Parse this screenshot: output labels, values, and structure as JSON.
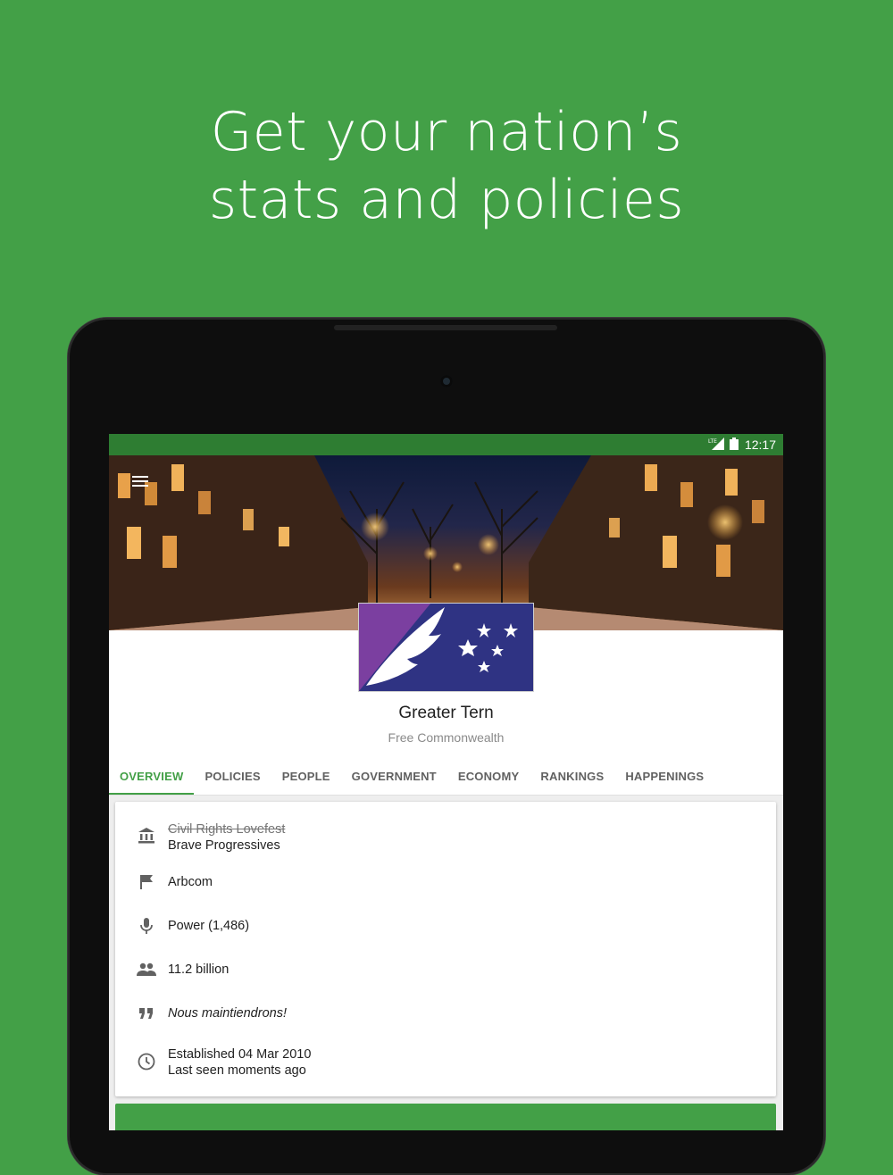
{
  "headline": {
    "line1": "Get your nation’s",
    "line2": "stats and policies"
  },
  "status_bar": {
    "time": "12:17",
    "network": "LTE"
  },
  "nation": {
    "name": "Greater Tern",
    "classification": "Free Commonwealth"
  },
  "tabs": [
    {
      "label": "OVERVIEW",
      "active": true
    },
    {
      "label": "POLICIES",
      "active": false
    },
    {
      "label": "PEOPLE",
      "active": false
    },
    {
      "label": "GOVERNMENT",
      "active": false
    },
    {
      "label": "ECONOMY",
      "active": false
    },
    {
      "label": "RANKINGS",
      "active": false
    },
    {
      "label": "HAPPENINGS",
      "active": false
    }
  ],
  "overview": {
    "category_old": "Civil Rights Lovefest",
    "category_new": "Brave Progressives",
    "region": "Arbcom",
    "influence": "Power (1,486)",
    "population": "11.2 billion",
    "motto": "Nous maintiendrons!",
    "established": "Established 04 Mar 2010",
    "last_seen": "Last seen moments ago"
  },
  "icons": {
    "category": "bank-icon",
    "region": "flag-icon",
    "influence": "microphone-icon",
    "population": "people-icon",
    "motto": "quote-icon",
    "time": "clock-icon"
  },
  "colors": {
    "background": "#43a047",
    "status_bar": "#2e7d32",
    "accent": "#43a047",
    "flag_blue": "#2f3383",
    "flag_purple": "#7b3fa0"
  }
}
